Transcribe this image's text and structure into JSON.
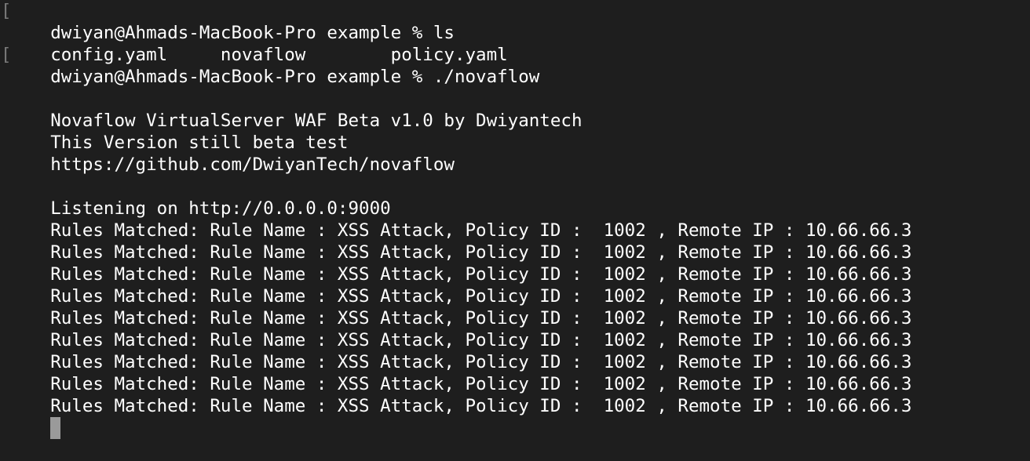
{
  "terminal": {
    "prompt_marker": "[",
    "lines": [
      {
        "type": "prompt",
        "text": "dwiyan@Ahmads-MacBook-Pro example % ls"
      },
      {
        "type": "output",
        "text": "config.yaml     novaflow        policy.yaml"
      },
      {
        "type": "prompt",
        "text": "dwiyan@Ahmads-MacBook-Pro example % ./novaflow"
      },
      {
        "type": "output",
        "text": ""
      },
      {
        "type": "output",
        "text": "Novaflow VirtualServer WAF Beta v1.0 by Dwiyantech"
      },
      {
        "type": "output",
        "text": "This Version still beta test"
      },
      {
        "type": "output",
        "text": "https://github.com/DwiyanTech/novaflow"
      },
      {
        "type": "output",
        "text": ""
      },
      {
        "type": "output",
        "text": "Listening on http://0.0.0.0:9000"
      },
      {
        "type": "output",
        "text": "Rules Matched: Rule Name : XSS Attack, Policy ID :  1002 , Remote IP : 10.66.66.3"
      },
      {
        "type": "output",
        "text": "Rules Matched: Rule Name : XSS Attack, Policy ID :  1002 , Remote IP : 10.66.66.3"
      },
      {
        "type": "output",
        "text": "Rules Matched: Rule Name : XSS Attack, Policy ID :  1002 , Remote IP : 10.66.66.3"
      },
      {
        "type": "output",
        "text": "Rules Matched: Rule Name : XSS Attack, Policy ID :  1002 , Remote IP : 10.66.66.3"
      },
      {
        "type": "output",
        "text": "Rules Matched: Rule Name : XSS Attack, Policy ID :  1002 , Remote IP : 10.66.66.3"
      },
      {
        "type": "output",
        "text": "Rules Matched: Rule Name : XSS Attack, Policy ID :  1002 , Remote IP : 10.66.66.3"
      },
      {
        "type": "output",
        "text": "Rules Matched: Rule Name : XSS Attack, Policy ID :  1002 , Remote IP : 10.66.66.3"
      },
      {
        "type": "output",
        "text": "Rules Matched: Rule Name : XSS Attack, Policy ID :  1002 , Remote IP : 10.66.66.3"
      },
      {
        "type": "output",
        "text": "Rules Matched: Rule Name : XSS Attack, Policy ID :  1002 , Remote IP : 10.66.66.3"
      }
    ],
    "colors": {
      "background": "#1e1e1e",
      "foreground": "#ffffff",
      "cursor": "#9a9a9a",
      "prompt_marker": "#7a7a7a"
    }
  }
}
